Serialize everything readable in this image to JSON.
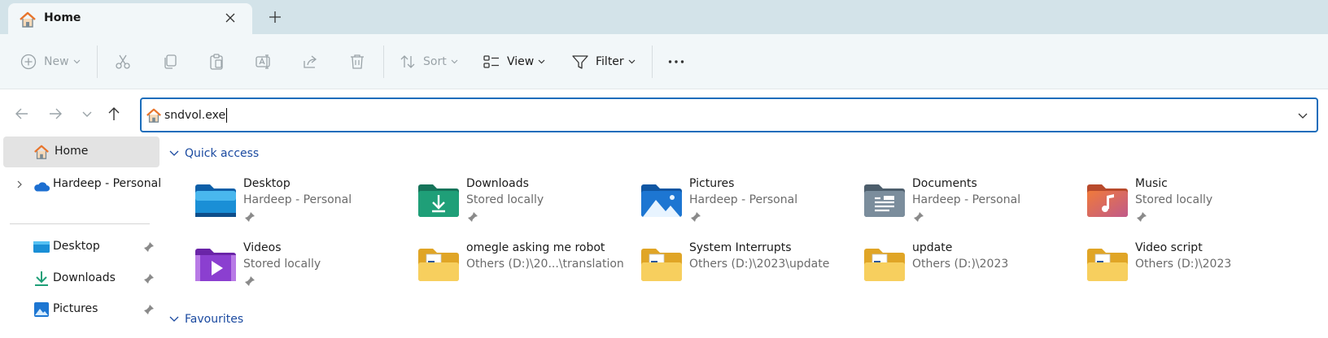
{
  "tab": {
    "title": "Home",
    "home_icon": "home-icon",
    "close_icon": "close-icon",
    "new_tab_icon": "plus-icon"
  },
  "toolbar": {
    "new_label": "New",
    "sort_label": "Sort",
    "view_label": "View",
    "filter_label": "Filter"
  },
  "address": {
    "value": "sndvol.exe"
  },
  "sidebar": {
    "items": [
      {
        "label": "Home"
      },
      {
        "label": "Hardeep - Personal"
      },
      {
        "label": "Desktop"
      },
      {
        "label": "Downloads"
      },
      {
        "label": "Pictures"
      }
    ]
  },
  "quick_access": {
    "header": "Quick access",
    "items": [
      {
        "title": "Desktop",
        "subtitle": "Hardeep - Personal",
        "icon": "desktop-folder-icon",
        "color": "#1a8fd6"
      },
      {
        "title": "Downloads",
        "subtitle": "Stored locally",
        "icon": "downloads-folder-icon",
        "color": "#1f9f78"
      },
      {
        "title": "Pictures",
        "subtitle": "Hardeep - Personal",
        "icon": "pictures-folder-icon",
        "color": "#1d76d2"
      },
      {
        "title": "Documents",
        "subtitle": "Hardeep - Personal",
        "icon": "documents-folder-icon",
        "color": "#6f8191"
      },
      {
        "title": "Music",
        "subtitle": "Stored locally",
        "icon": "music-folder-icon",
        "color": "#e2673f"
      },
      {
        "title": "Videos",
        "subtitle": "Stored locally",
        "icon": "videos-folder-icon",
        "color": "#8b3fd0"
      },
      {
        "title": "omegle asking me robot",
        "subtitle": "Others (D:)\\20...\\translation",
        "icon": "folder-icon",
        "color": "#f3c24c"
      },
      {
        "title": "System Interrupts",
        "subtitle": "Others (D:)\\2023\\update",
        "icon": "folder-icon",
        "color": "#f3c24c"
      },
      {
        "title": "update",
        "subtitle": "Others (D:)\\2023",
        "icon": "folder-icon",
        "color": "#f3c24c"
      },
      {
        "title": "Video script",
        "subtitle": "Others (D:)\\2023",
        "icon": "folder-icon",
        "color": "#f3c24c"
      }
    ]
  },
  "favourites": {
    "header": "Favourites"
  }
}
